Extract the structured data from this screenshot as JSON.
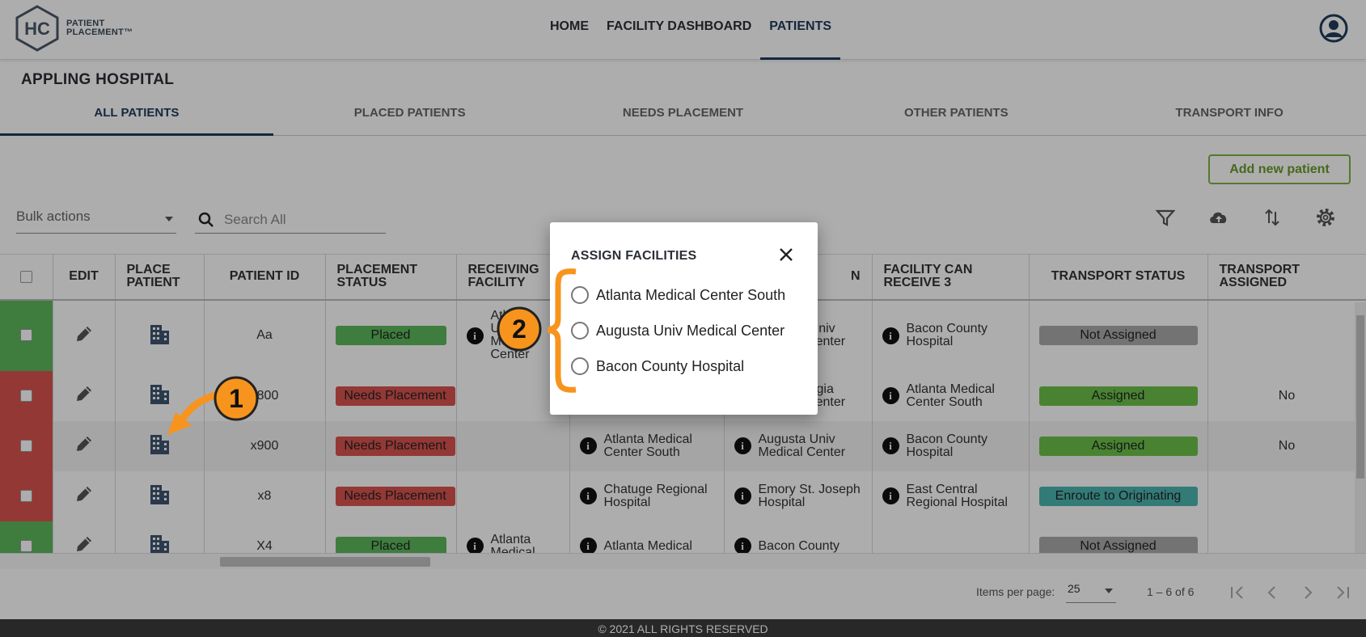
{
  "header": {
    "logo_mark": "HC",
    "logo_line1": "PATIENT",
    "logo_line2": "PLACEMENT™",
    "nav": [
      "HOME",
      "FACILITY DASHBOARD",
      "PATIENTS"
    ],
    "active_nav": "PATIENTS"
  },
  "hospital_name": "APPLING HOSPITAL",
  "tabs": [
    "ALL PATIENTS",
    "PLACED PATIENTS",
    "NEEDS PLACEMENT",
    "OTHER PATIENTS",
    "TRANSPORT INFO"
  ],
  "active_tab": "ALL PATIENTS",
  "add_button": "Add new patient",
  "bulk_actions": "Bulk actions",
  "search": {
    "placeholder": "Search All"
  },
  "toolbar_icons": [
    "filter-icon",
    "upload-icon",
    "sort-icon",
    "settings-icon"
  ],
  "table": {
    "headers": {
      "edit": "EDIT",
      "place1": "PLACE",
      "place2": "PATIENT",
      "patient_id": "PATIENT ID",
      "status1": "PLACEMENT",
      "status2": "STATUS",
      "recv1": "RECEIVING",
      "recv2": "FACILITY",
      "fac2_1": "",
      "fac2_2": "N",
      "fac3_1": "FACILITY CAN",
      "fac3_2": "RECEIVE 3",
      "transport_status": "TRANSPORT STATUS",
      "ta1": "TRANSPORT",
      "ta2": "ASSIGNED"
    },
    "rows": [
      {
        "flag": "#5cb85c",
        "patient_id": "Aa",
        "status": "Placed",
        "receiving": "Atlanta Univ Medical Center",
        "fac1": "",
        "fac2": "Augusta Univ Medical Center",
        "fac3": "Bacon County Hospital",
        "transport_status": "Not Assigned",
        "transport_assigned": ""
      },
      {
        "flag": "#d9534f",
        "patient_id": "x800",
        "status": "Needs Placement",
        "receiving": "",
        "fac1": "",
        "fac2": "East Georgia Medical Center",
        "fac3": "Atlanta Medical Center South",
        "transport_status": "Assigned",
        "transport_assigned": "No"
      },
      {
        "flag": "#d9534f",
        "patient_id": "x900",
        "status": "Needs Placement",
        "receiving": "",
        "fac1": "Atlanta Medical Center South",
        "fac2": "Augusta Univ Medical Center",
        "fac3": "Bacon County Hospital",
        "transport_status": "Assigned",
        "transport_assigned": "No"
      },
      {
        "flag": "#d9534f",
        "patient_id": "x8",
        "status": "Needs Placement",
        "receiving": "",
        "fac1": "Chatuge Regional Hospital",
        "fac2": "Emory St. Joseph Hospital",
        "fac3": "East Central Regional Hospital",
        "transport_status": "Enroute to Originating",
        "transport_assigned": ""
      },
      {
        "flag": "#5cb85c",
        "patient_id": "X4",
        "status": "Placed",
        "receiving": "Atlanta Medical",
        "fac1": "Atlanta Medical",
        "fac2": "Bacon County",
        "fac3": "",
        "transport_status": "Not Assigned",
        "transport_assigned": ""
      }
    ]
  },
  "paginator": {
    "items_per_page_label": "Items per page:",
    "page_size": "25",
    "range": "1 – 6 of 6"
  },
  "footer": "© 2021 ALL RIGHTS RESERVED",
  "modal": {
    "title": "ASSIGN FACILITIES",
    "options": [
      "Atlanta Medical Center South",
      "Augusta Univ Medical Center",
      "Bacon County Hospital"
    ]
  },
  "annotations": [
    "1",
    "2"
  ],
  "colors": {
    "primary": "#1f3b5c",
    "accent_green": "#7cb342",
    "placed": "#5cb85c",
    "needs": "#d9534f",
    "annotation": "#f7941d"
  }
}
